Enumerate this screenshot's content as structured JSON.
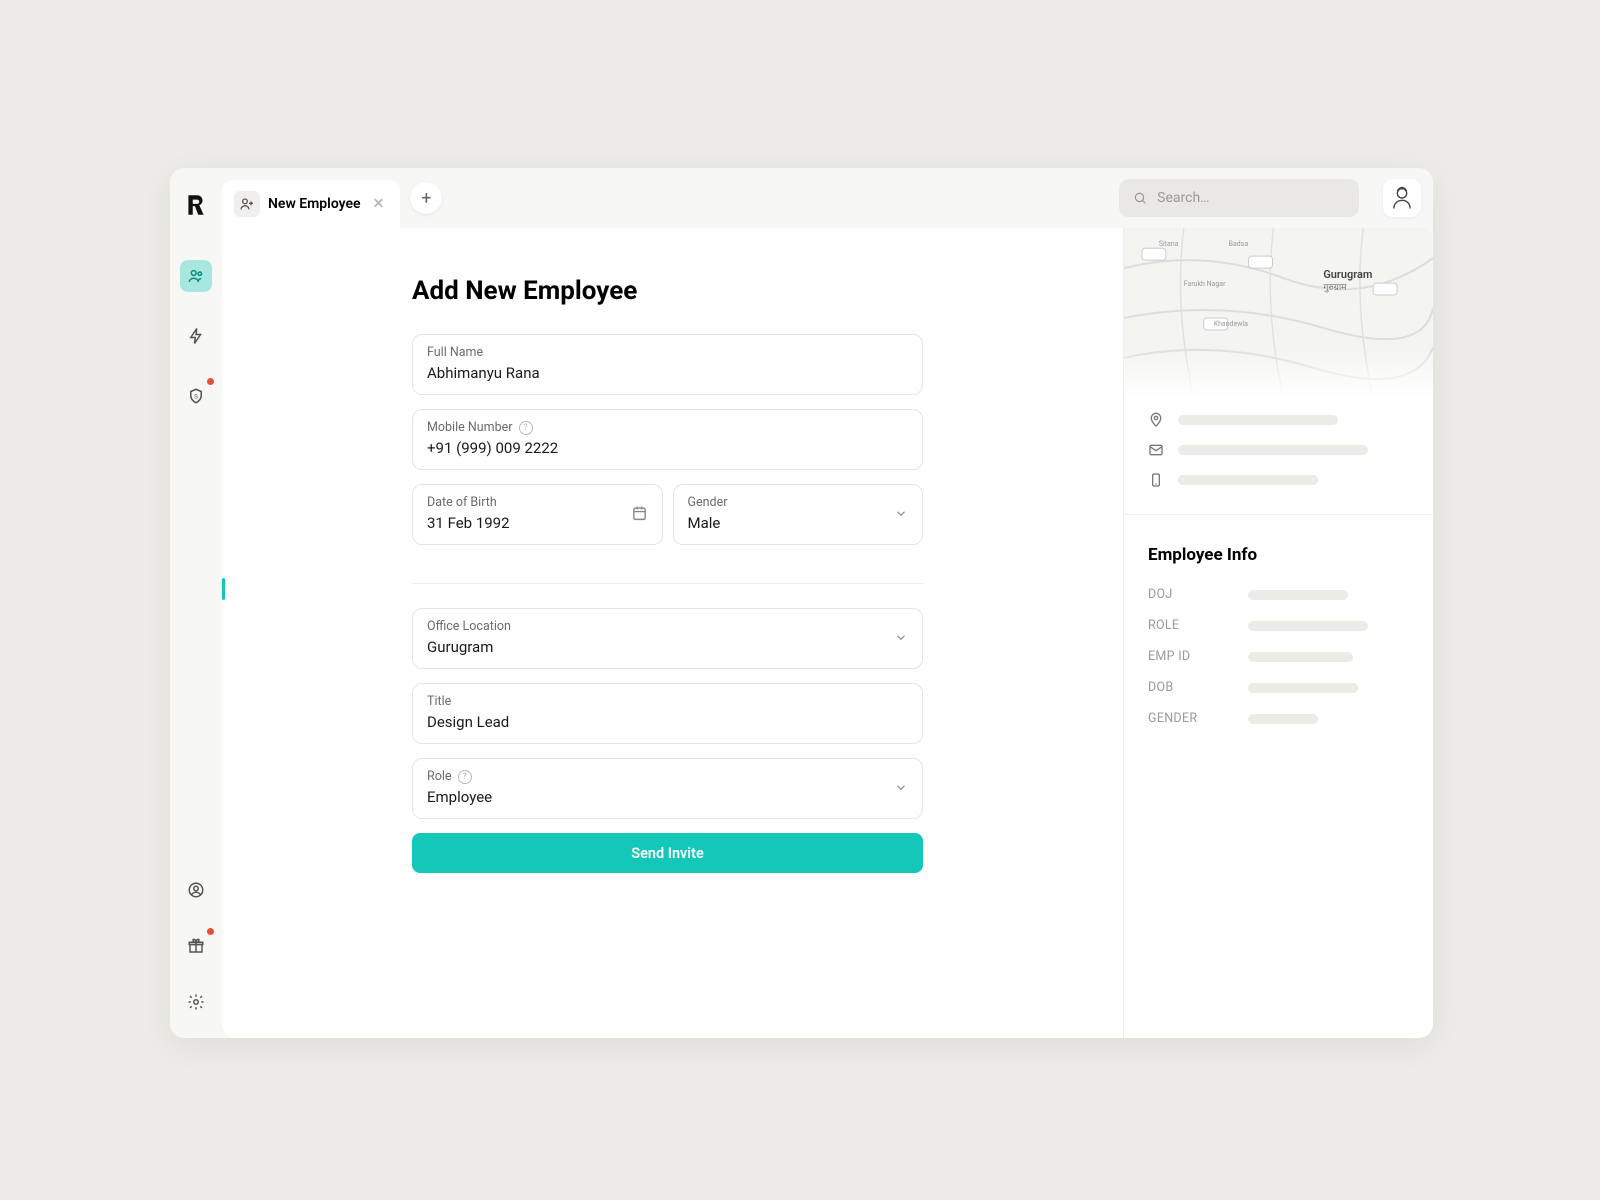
{
  "tab": {
    "label": "New Employee"
  },
  "search": {
    "placeholder": "Search…"
  },
  "page": {
    "title": "Add New Employee"
  },
  "form": {
    "fullName": {
      "label": "Full Name",
      "value": "Abhimanyu Rana"
    },
    "mobile": {
      "label": "Mobile Number",
      "value": "+91 (999) 009 2222"
    },
    "dob": {
      "label": "Date of Birth",
      "value": "31 Feb 1992"
    },
    "gender": {
      "label": "Gender",
      "value": "Male"
    },
    "office": {
      "label": "Office Location",
      "value": "Gurugram"
    },
    "title": {
      "label": "Title",
      "value": "Design Lead"
    },
    "role": {
      "label": "Role",
      "value": "Employee"
    },
    "submit": "Send Invite"
  },
  "info": {
    "heading": "Employee Info",
    "rows": [
      {
        "label": "DOJ"
      },
      {
        "label": "ROLE"
      },
      {
        "label": "EMP ID"
      },
      {
        "label": "DOB"
      },
      {
        "label": "GENDER"
      }
    ]
  },
  "map": {
    "city": "Gurugram",
    "city_native": "गुरुग्राम"
  }
}
